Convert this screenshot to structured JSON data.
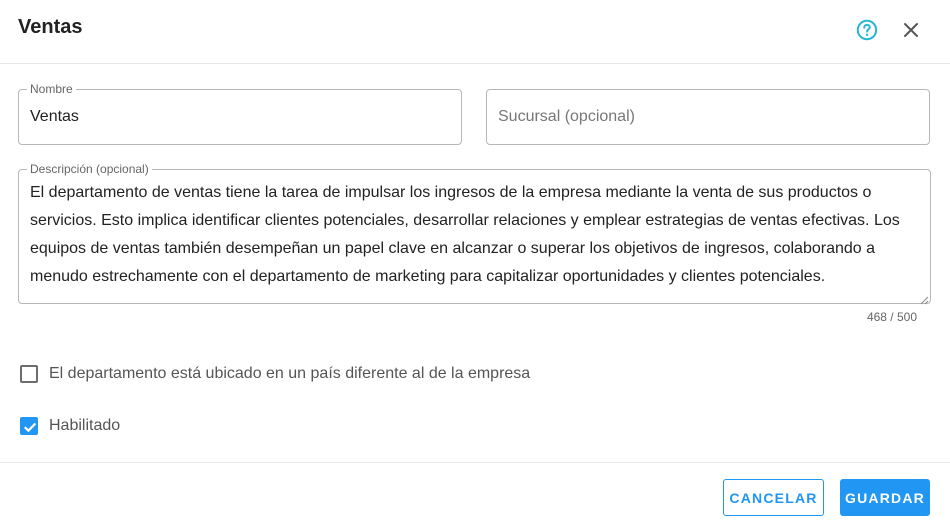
{
  "dialog": {
    "title": "Ventas",
    "help_icon": "help-circle-icon",
    "close_icon": "close-icon"
  },
  "form": {
    "name": {
      "label": "Nombre",
      "value": "Ventas"
    },
    "branch": {
      "label": "Sucursal (opcional)",
      "value": ""
    },
    "description": {
      "label": "Descripción (opcional)",
      "value": "El departamento de ventas tiene la tarea de impulsar los ingresos de la empresa mediante la venta de sus productos o servicios. Esto implica identificar clientes potenciales, desarrollar relaciones y emplear estrategias de ventas efectivas. Los equipos de ventas también desempeñan un papel clave en alcanzar o superar los objetivos de ingresos, colaborando a menudo estrechamente con el departamento de marketing para capitalizar oportunidades y clientes potenciales.",
      "counter": "468 / 500"
    },
    "different_country": {
      "label": "El departamento está ubicado en un país diferente al de la empresa",
      "checked": false
    },
    "enabled": {
      "label": "Habilitado",
      "checked": true
    }
  },
  "actions": {
    "cancel_label": "CANCELAR",
    "save_label": "GUARDAR"
  },
  "colors": {
    "accent": "#2196f3",
    "help_icon": "#29b6d6"
  }
}
